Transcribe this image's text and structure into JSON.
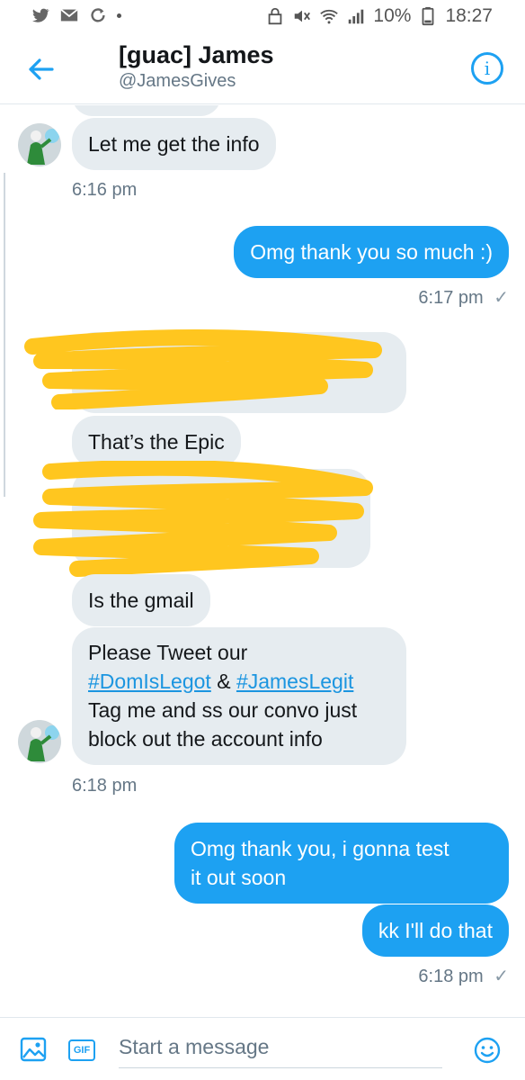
{
  "status_bar": {
    "battery": "10%",
    "time": "18:27"
  },
  "header": {
    "name": "[guac] James",
    "handle": "@JamesGives"
  },
  "messages": [
    {
      "text": "Let me get the info"
    },
    {
      "timestamp": "6:16 pm"
    },
    {
      "text": "Omg thank you so much :)"
    },
    {
      "timestamp": "6:17 pm",
      "check": "✓"
    },
    {
      "text": "That’s the Epic"
    },
    {
      "text": "Is the gmail"
    },
    {
      "line1_prefix": "Please Tweet our",
      "hashtag1": "#DomIsLegot",
      "amp": "&",
      "hashtag2": "#JamesLegit",
      "line3": "Tag me and ss our convo just",
      "line4": "block out the account info"
    },
    {
      "timestamp": "6:18 pm"
    },
    {
      "line1": "Omg thank you, i gonna test",
      "line2": "it out soon"
    },
    {
      "text": "kk I'll do that"
    },
    {
      "timestamp": "6:18 pm",
      "check": "✓"
    }
  ],
  "composer": {
    "placeholder": "Start a message",
    "gif_label": "GIF"
  },
  "colors": {
    "accent": "#1da1f2",
    "incoming_bubble": "#e6ecf0",
    "redaction": "#ffc61f"
  }
}
